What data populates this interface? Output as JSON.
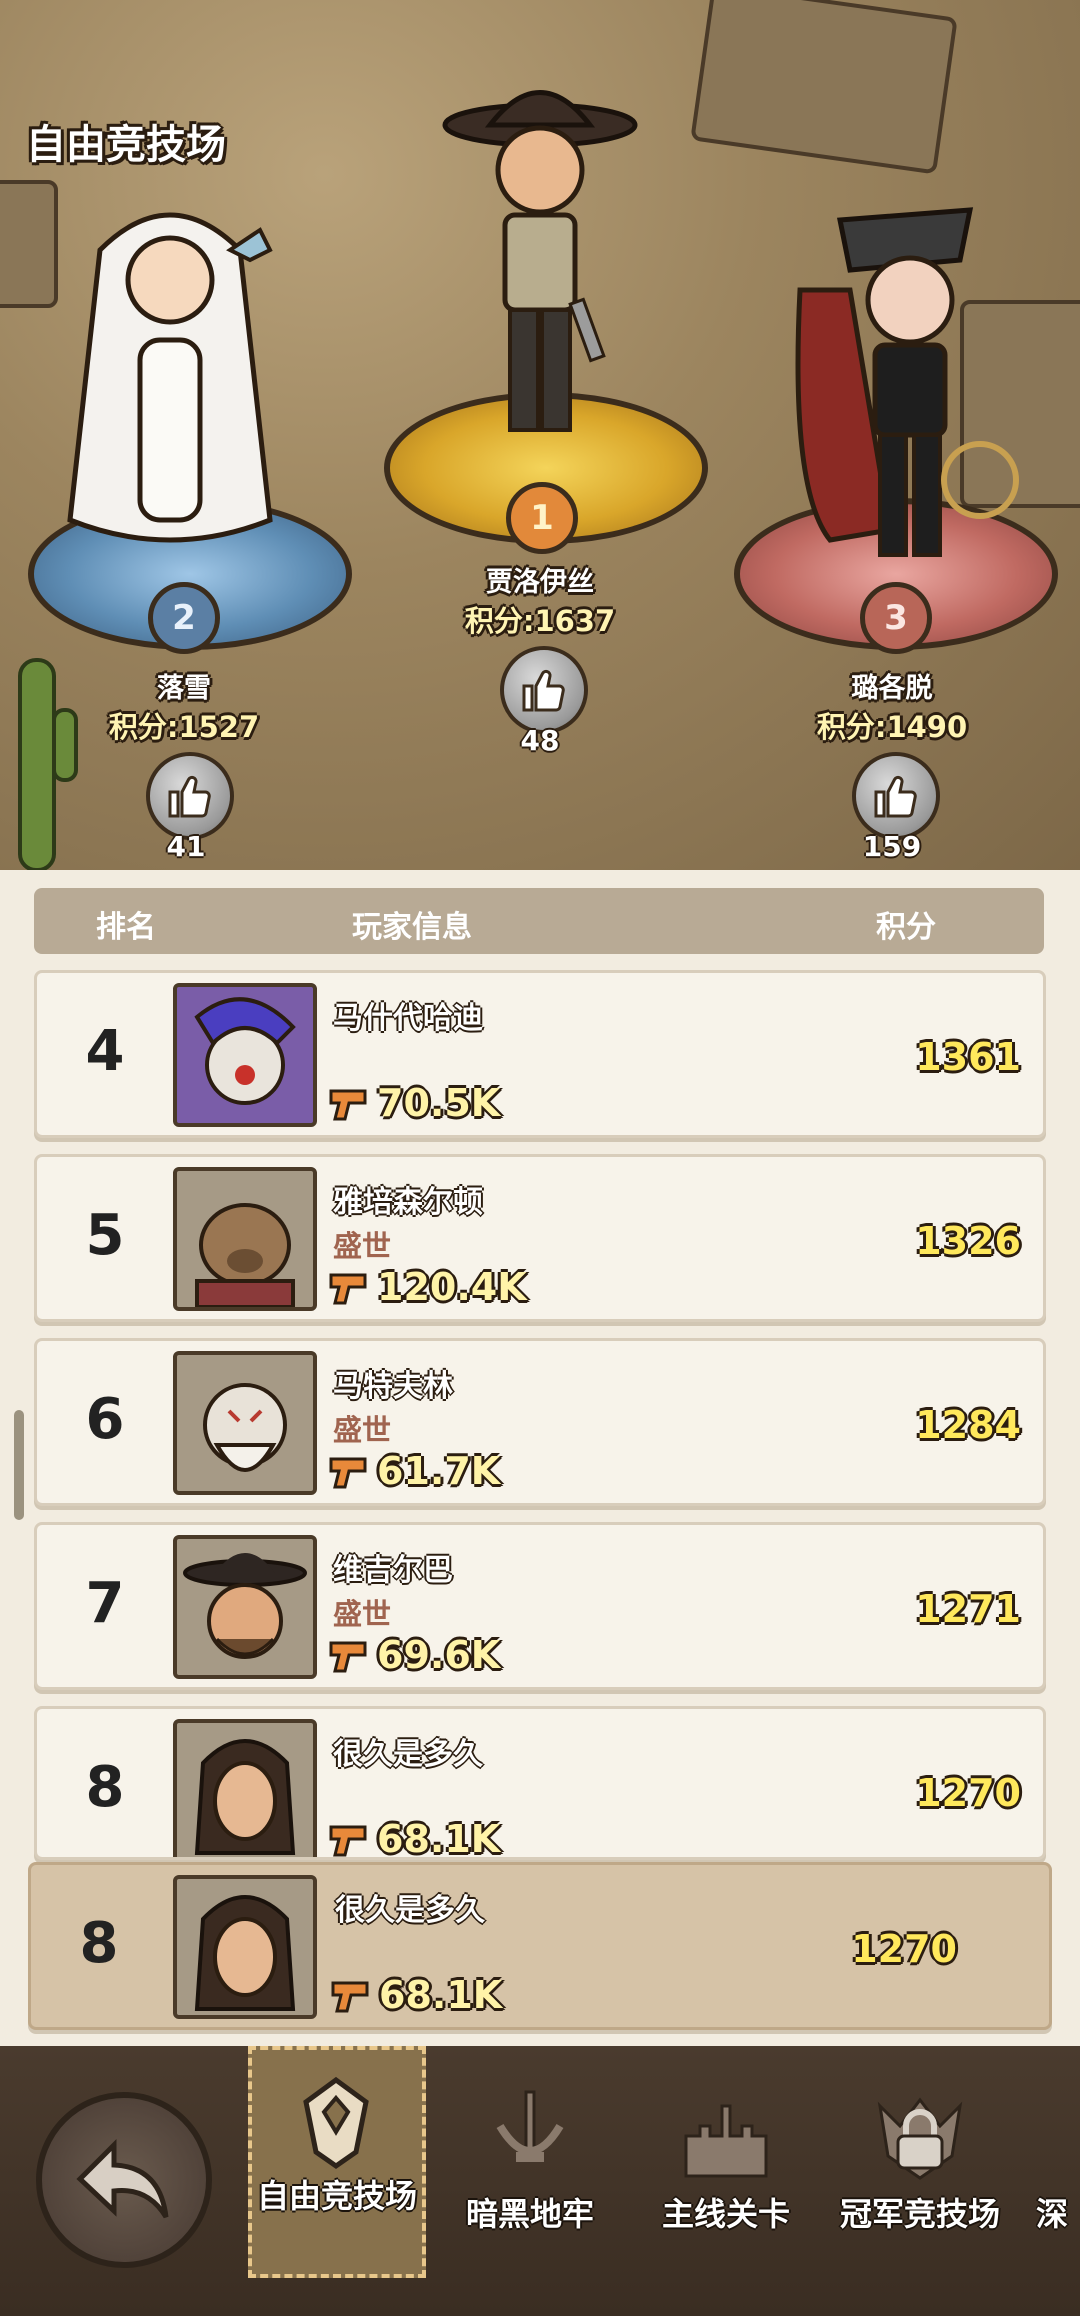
{
  "arena": {
    "title": "自由竞技场"
  },
  "podium": [
    {
      "rank": "1",
      "name": "贾洛伊丝",
      "score_text": "积分:1637",
      "likes": "48"
    },
    {
      "rank": "2",
      "name": "落雪",
      "score_text": "积分:1527",
      "likes": "41"
    },
    {
      "rank": "3",
      "name": "璐各脱",
      "score_text": "积分:1490",
      "likes": "159"
    }
  ],
  "list": {
    "header": {
      "rank": "排名",
      "info": "玩家信息",
      "score": "积分"
    },
    "rows": [
      {
        "rank": "4",
        "name": "马什代哈迪",
        "guild": "",
        "power": "70.5K",
        "score": "1361"
      },
      {
        "rank": "5",
        "name": "雅培森尔顿",
        "guild": "盛世",
        "power": "120.4K",
        "score": "1326"
      },
      {
        "rank": "6",
        "name": "马特夫林",
        "guild": "盛世",
        "power": "61.7K",
        "score": "1284"
      },
      {
        "rank": "7",
        "name": "维吉尔巴",
        "guild": "盛世",
        "power": "69.6K",
        "score": "1271"
      },
      {
        "rank": "8",
        "name": "很久是多久",
        "guild": "",
        "power": "68.1K",
        "score": "1270"
      }
    ],
    "me": {
      "rank": "8",
      "name": "很久是多久",
      "power": "68.1K",
      "score": "1270"
    }
  },
  "nav": {
    "tabs": [
      {
        "label": "自由竞技场",
        "active": true
      },
      {
        "label": "暗黑地牢",
        "active": false
      },
      {
        "label": "主线关卡",
        "active": false
      },
      {
        "label": "冠军竞技场",
        "active": false,
        "locked": true
      },
      {
        "label": "深",
        "active": false
      }
    ]
  },
  "colors": {
    "gold": "#ffe85c",
    "guild": "#a0644f",
    "header_bg": "#b8aa95",
    "nav_bg": "#3a2d22"
  }
}
